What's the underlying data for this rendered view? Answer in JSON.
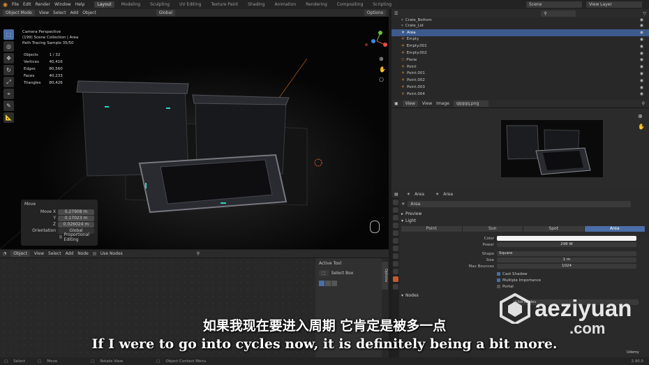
{
  "menu": [
    "File",
    "Edit",
    "Render",
    "Window",
    "Help"
  ],
  "workspaces": [
    {
      "label": "Layout",
      "active": true
    },
    {
      "label": "Modeling"
    },
    {
      "label": "Sculpting"
    },
    {
      "label": "UV Editing"
    },
    {
      "label": "Texture Paint"
    },
    {
      "label": "Shading"
    },
    {
      "label": "Animation"
    },
    {
      "label": "Rendering"
    },
    {
      "label": "Compositing"
    },
    {
      "label": "Scripting"
    }
  ],
  "scene": {
    "label": "Scene"
  },
  "view_layer": {
    "label": "View Layer"
  },
  "viewport_header": {
    "mode": "Object Mode",
    "view": "View",
    "select": "Select",
    "add": "Add",
    "object": "Object",
    "transform_orientation": "Global",
    "options": "Options"
  },
  "viewport_info": {
    "line1": "Camera Perspective",
    "line2": "(199) Scene Collection | Area",
    "line3": "Path Tracing Sample 35/50"
  },
  "stats": [
    {
      "label": "Objects",
      "value": "1 / 32"
    },
    {
      "label": "Vertices",
      "value": "40,416"
    },
    {
      "label": "Edges",
      "value": "80,560"
    },
    {
      "label": "Faces",
      "value": "40,233"
    },
    {
      "label": "Triangles",
      "value": "80,426"
    }
  ],
  "move_panel": {
    "title": "Move",
    "rows": [
      {
        "label": "Move X",
        "value": "0.27908 m"
      },
      {
        "label": "Y",
        "value": "0.17023 m"
      },
      {
        "label": "Z",
        "value": "0.026024 m"
      }
    ],
    "orientation_label": "Orientation",
    "orientation_value": "Global",
    "proportional": "Proportional Editing"
  },
  "node_header": {
    "type": "Object",
    "view": "View",
    "select": "Select",
    "add": "Add",
    "node": "Node",
    "use_nodes": "Use Nodes"
  },
  "tool_panel": {
    "title": "Active Tool",
    "tool": "Select Box",
    "side_tab": "Options"
  },
  "outliner": {
    "search_placeholder": "",
    "rows": [
      {
        "label": "Crate_Bottom"
      },
      {
        "label": "Crate_Lid"
      },
      {
        "label": "Area",
        "selected": true
      },
      {
        "label": "Empty"
      },
      {
        "label": "Empty.001"
      },
      {
        "label": "Empty.002"
      },
      {
        "label": "Plane"
      },
      {
        "label": "Point"
      },
      {
        "label": "Point.001"
      },
      {
        "label": "Point.002"
      },
      {
        "label": "Point.003"
      },
      {
        "label": "Point.004"
      }
    ]
  },
  "image_editor": {
    "view": "View",
    "view2": "View",
    "image": "Image",
    "filename": "qqqqq.png"
  },
  "properties": {
    "object_name": "Area",
    "data_name": "Area",
    "data_field": "Area",
    "section_preview": "Preview",
    "section_light": "Light",
    "light_types": [
      {
        "label": "Point"
      },
      {
        "label": "Sun"
      },
      {
        "label": "Spot"
      },
      {
        "label": "Area",
        "active": true
      }
    ],
    "color_label": "Color",
    "power_label": "Power",
    "power_value": "298 W",
    "shape_label": "Shape",
    "shape_value": "Square",
    "size_label": "Size",
    "size_value": "1 m",
    "bounces_label": "Max Bounces",
    "bounces_value": "1024",
    "cast_shadow": "Cast Shadow",
    "mis": "Multiple Importance",
    "portal": "Portal",
    "section_nodes": "Nodes",
    "use_nodes": "Use Nodes"
  },
  "status_bar": [
    "Select",
    "Move",
    "Rotate View",
    "Object Context Menu"
  ],
  "version": "2.90.0",
  "udemy": "Udemy",
  "subtitle_cn": "如果我现在要进入周期 它肯定是被多一点",
  "subtitle_en": "If I were to go into cycles now, it is definitely being a bit more.",
  "watermark_main": "aeziyuan",
  "watermark_sub": ".com",
  "colors": {
    "accent": "#4a6ea8",
    "selected_row": "#3d5a8e",
    "light_tab": "#c65a2e",
    "background": "#1d1d1d"
  }
}
